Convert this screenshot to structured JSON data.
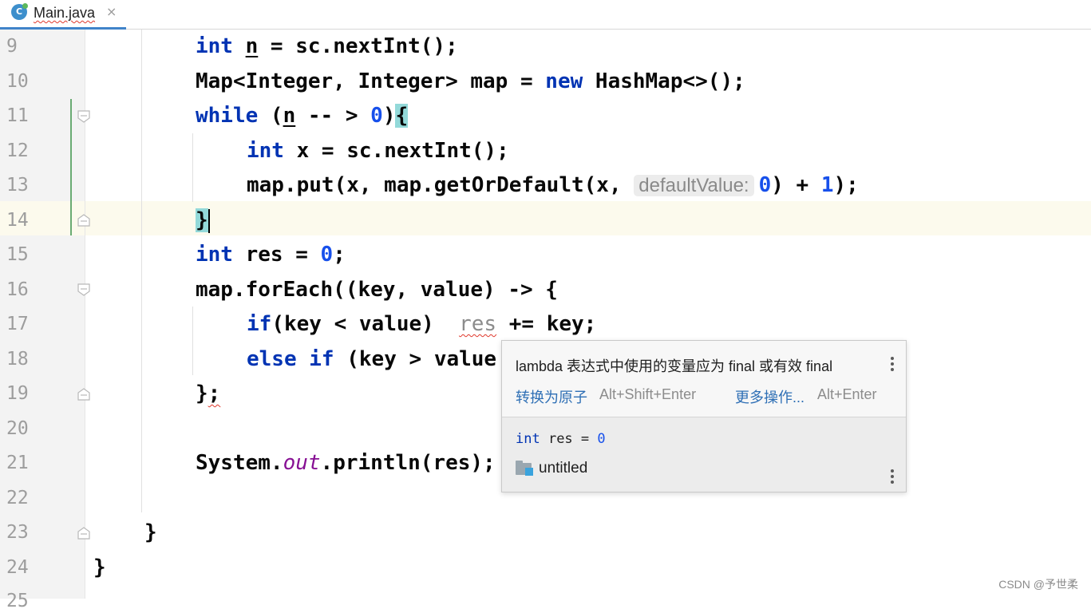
{
  "tab": {
    "title": "Main.java",
    "icon_letter": "C",
    "close": "×"
  },
  "gutter": {
    "line_numbers": [
      "9",
      "10",
      "11",
      "12",
      "13",
      "14",
      "15",
      "16",
      "17",
      "18",
      "19",
      "20",
      "21",
      "22",
      "23",
      "24",
      "25"
    ]
  },
  "code": {
    "l9": [
      "int",
      " ",
      "n",
      " = sc.nextInt();"
    ],
    "l10": [
      "Map<Integer, Integer> map = ",
      "new",
      " HashMap<>();"
    ],
    "l11": [
      "while",
      " (",
      "n",
      " -- > ",
      "0",
      ")",
      "{"
    ],
    "l12": [
      "int",
      " x = sc.nextInt();"
    ],
    "l13": [
      "map.put(x, map.getOrDefault(x, ",
      "defaultValue:",
      "0",
      ") + ",
      "1",
      ");"
    ],
    "l14": [
      "}"
    ],
    "l15": [
      "int",
      " res = ",
      "0",
      ";"
    ],
    "l16": [
      "map.forEach((key, value) -> {"
    ],
    "l17": [
      "if",
      "(key < value)  ",
      "res",
      " += key;"
    ],
    "l18": [
      "else",
      " ",
      "if",
      " (key > value"
    ],
    "l19": [
      "}",
      ";"
    ],
    "l21": [
      "System.",
      "out",
      ".println(res);"
    ],
    "l23": [
      "}"
    ],
    "l24": [
      "}"
    ]
  },
  "popup": {
    "message": "lambda 表达式中使用的变量应为 final 或有效 final",
    "action1_label": "转换为原子",
    "action1_shortcut": "Alt+Shift+Enter",
    "action2_label": "更多操作...",
    "action2_shortcut": "Alt+Enter",
    "decl_keyword": "int",
    "decl_rest": " res = ",
    "decl_value": "0",
    "project": "untitled"
  },
  "watermark": "CSDN @予世柔",
  "colors": {
    "keyword": "#0033b3",
    "number": "#1750eb",
    "field": "#871094",
    "link": "#2e6fb5",
    "accent": "#4083c9"
  }
}
